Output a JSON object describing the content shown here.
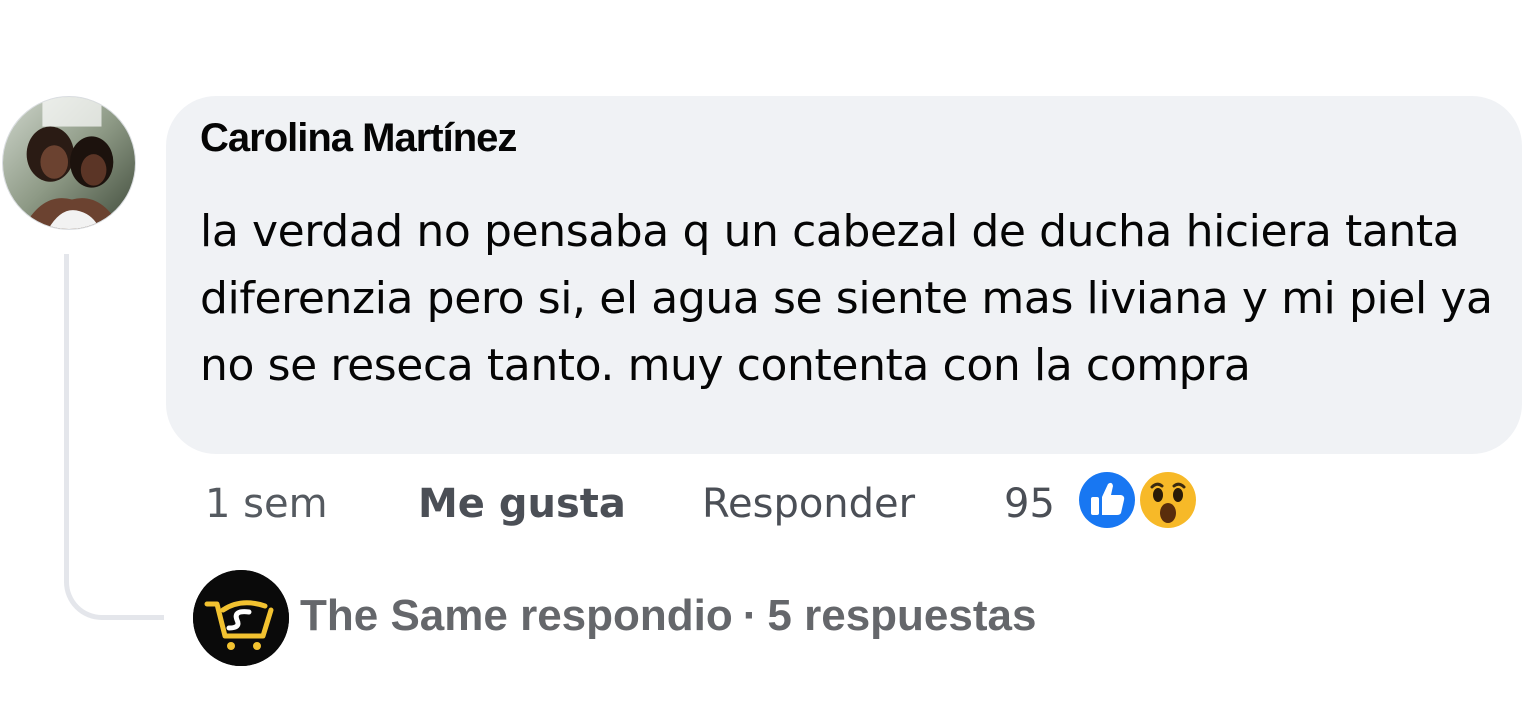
{
  "comment": {
    "author": "Carolina Martínez",
    "text": "la verdad no pensaba q un cabezal de ducha hiciera tanta diferenzia pero si, el agua se siente mas liviana y mi piel ya no se reseca tanto. muy contenta con la compra",
    "time": "1 sem",
    "like_label": "Me gusta",
    "reply_label": "Responder",
    "reaction_count": "95",
    "reactions": [
      "like-icon",
      "wow-icon"
    ]
  },
  "reply_summary": {
    "responder": "The Same respondio",
    "separator": "·",
    "replies_label": "5 respuestas"
  },
  "colors": {
    "bubble": "#f0f2f5",
    "like_blue": "#1877f2",
    "wow_yellow": "#f7b928",
    "muted_text": "#65676b"
  }
}
